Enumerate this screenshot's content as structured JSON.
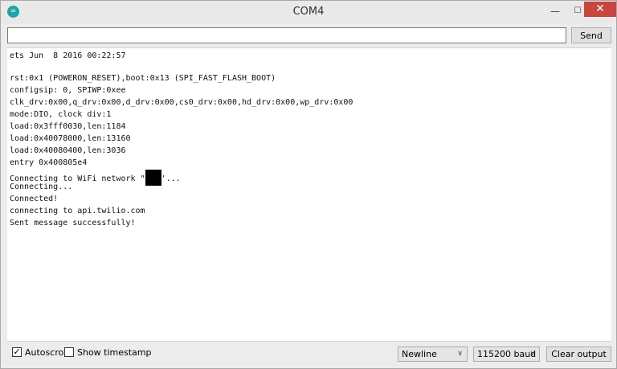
{
  "window": {
    "title": "COM4",
    "minimize_glyph": "—",
    "maximize_glyph": "☐",
    "close_glyph": "✕",
    "app_icon": "∞"
  },
  "input": {
    "value": "",
    "placeholder": ""
  },
  "send_button": {
    "label": "Send"
  },
  "output_lines": [
    "ets Jun  8 2016 00:22:57",
    "",
    "rst:0x1 (POWERON_RESET),boot:0x13 (SPI_FAST_FLASH_BOOT)",
    "configsip: 0, SPIWP:0xee",
    "clk_drv:0x00,q_drv:0x00,d_drv:0x00,cs0_drv:0x00,hd_drv:0x00,wp_drv:0x00",
    "mode:DIO, clock div:1",
    "load:0x3fff0030,len:1184",
    "load:0x40078000,len:13160",
    "load:0x40080400,len:3036",
    "entry 0x400805e4",
    "Connecting to WiFi network ",
    "Connecting...",
    "Connected!",
    "connecting to api.twilio.com",
    "Sent message successfully!"
  ],
  "wifi_line_suffix": "'...",
  "wifi_line_prefix_quote": "\"",
  "autoscroll": {
    "label": "Autoscroll",
    "checked": true,
    "check_glyph": "✓"
  },
  "show_timestamp": {
    "label": "Show timestamp",
    "checked": false
  },
  "line_ending": {
    "selected": "Newline"
  },
  "baud_rate": {
    "selected": "115200 baud"
  },
  "clear_button": {
    "label": "Clear output"
  },
  "chevron_glyph": "∨"
}
